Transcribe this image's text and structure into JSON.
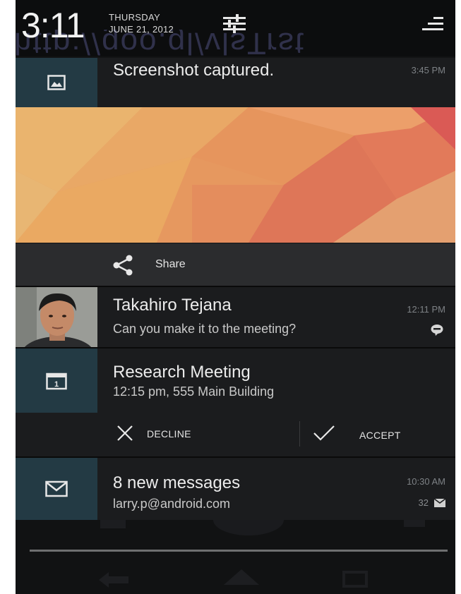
{
  "status": {
    "time": "3:11",
    "day": "THURSDAY",
    "date": "JUNE 21, 2012",
    "header_ghost_text": "http://goo.gl/vlsTrst"
  },
  "notifications": [
    {
      "type": "screenshot",
      "icon": "image-icon",
      "title": "Screenshot captured.",
      "time": "3:45 PM",
      "share_label": "Share"
    },
    {
      "type": "message",
      "icon": "avatar",
      "title": "Takahiro Tejana",
      "subtitle": "Can you make it to the meeting?",
      "time": "12:11 PM",
      "badge_icon": "talk-bubble-icon"
    },
    {
      "type": "calendar",
      "icon": "calendar-icon",
      "title": "Research Meeting",
      "subtitle": "12:15 pm, 555 Main Building",
      "calendar_day": "1",
      "actions": {
        "decline_label": "DECLINE",
        "accept_label": "ACCEPT"
      }
    },
    {
      "type": "email",
      "icon": "mail-icon",
      "title": "8 new messages",
      "subtitle": "larry.p@android.com",
      "time": "10:30 AM",
      "count": "32"
    }
  ],
  "colors": {
    "icon_cell": "#233a44",
    "row_bg": "#1b1c1e",
    "panel_bg": "#121314"
  }
}
